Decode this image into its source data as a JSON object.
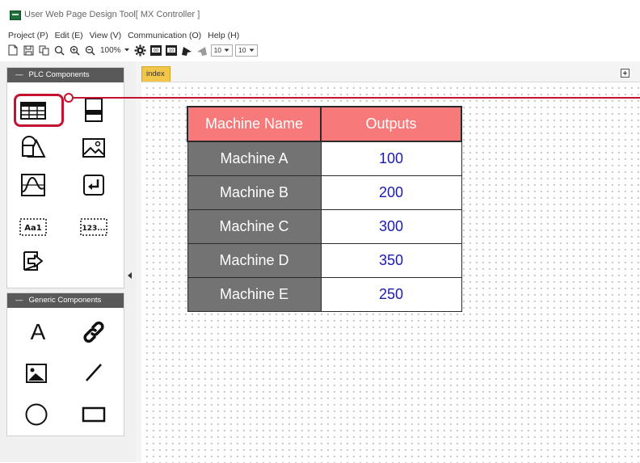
{
  "window": {
    "title": "User Web Page Design Tool[ MX Controller ]"
  },
  "menu": [
    "Project (P)",
    "Edit (E)",
    "View (V)",
    "Communication (O)",
    "Help (H)"
  ],
  "toolbar": {
    "zoom": "100%",
    "font_size_1": "10",
    "font_size_2": "10"
  },
  "left_panel": {
    "plc_header": "PLC Components",
    "plc_items": [
      "table-icon",
      "lamp-icon",
      "shapes-icon",
      "image-icon",
      "graph-icon",
      "enter-icon",
      "text-display-icon",
      "numeric-display-icon",
      "screen-switch-icon"
    ],
    "generic_header": "Generic Components",
    "generic_items": [
      "text-icon",
      "link-icon",
      "picture-icon",
      "line-icon",
      "circle-icon",
      "rectangle-icon"
    ],
    "generic_text_glyph": "A",
    "text_display_label": "Aa1",
    "numeric_display_label": "123..."
  },
  "tabs": {
    "active": "index"
  },
  "table": {
    "headers": [
      "Machine Name",
      "Outputs"
    ],
    "rows": [
      {
        "name": "Machine A",
        "value": "100"
      },
      {
        "name": "Machine B",
        "value": "200"
      },
      {
        "name": "Machine C",
        "value": "300"
      },
      {
        "name": "Machine D",
        "value": "350"
      },
      {
        "name": "Machine E",
        "value": "250"
      }
    ]
  },
  "colors": {
    "header_bg": "#f87979",
    "name_cell_bg": "#737373",
    "value_text": "#1a1ab0",
    "highlight": "#c41230",
    "tab_bg": "#f3c64a"
  }
}
